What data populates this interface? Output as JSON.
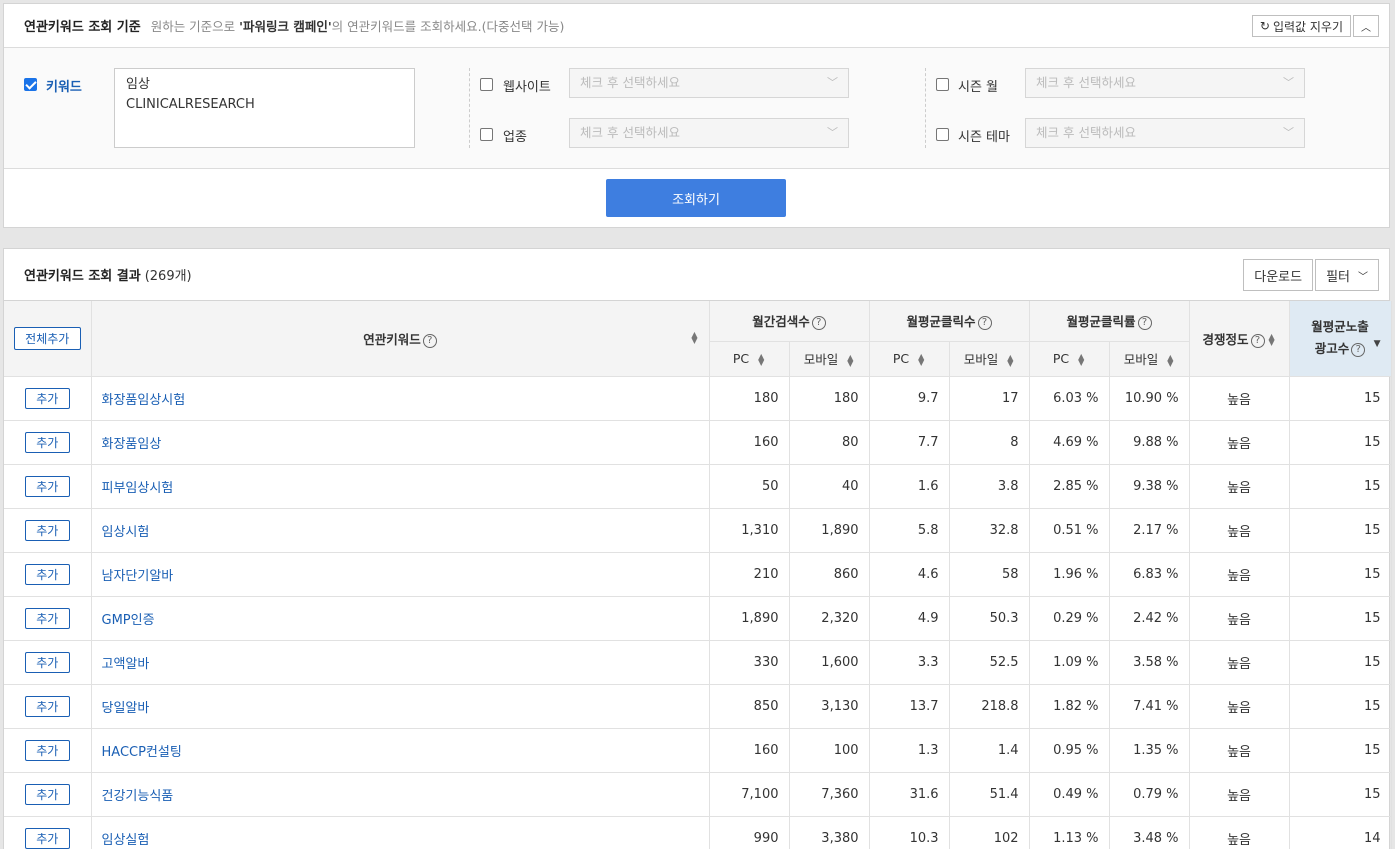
{
  "criteria": {
    "title": "연관키워드 조회 기준",
    "desc_before": "원하는 기준으로 ",
    "desc_bold": "'파워링크 캠페인'",
    "desc_after": "의 연관키워드를 조회하세요.(다중선택 가능)",
    "reset_label": "입력값 지우기",
    "collapse_icon": "chevron-up-icon",
    "keyword_label": "키워드",
    "keyword_lines": [
      "임상",
      "CLINICALRESEARCH"
    ],
    "website_label": "웹사이트",
    "industry_label": "업종",
    "season_month_label": "시즌 월",
    "season_theme_label": "시즌 테마",
    "select_placeholder": "체크 후 선택하세요",
    "search_label": "조회하기"
  },
  "results": {
    "title": "연관키워드 조회 결과",
    "count": "(269개)",
    "download_label": "다운로드",
    "filter_label": "필터",
    "add_all_label": "전체추가",
    "add_label": "추가",
    "headers": {
      "keyword": "연관키워드",
      "monthly_search": "월간검색수",
      "avg_clicks": "월평균클릭수",
      "avg_ctr": "월평균클릭률",
      "competition": "경쟁정도",
      "ad_count_1": "월평균노출",
      "ad_count_2": "광고수",
      "pc": "PC",
      "mobile": "모바일"
    },
    "rows": [
      {
        "kw": "화장품임상시험",
        "s_pc": "180",
        "s_mo": "180",
        "c_pc": "9.7",
        "c_mo": "17",
        "r_pc": "6.03 %",
        "r_mo": "10.90 %",
        "comp": "높음",
        "ads": "15"
      },
      {
        "kw": "화장품임상",
        "s_pc": "160",
        "s_mo": "80",
        "c_pc": "7.7",
        "c_mo": "8",
        "r_pc": "4.69 %",
        "r_mo": "9.88 %",
        "comp": "높음",
        "ads": "15"
      },
      {
        "kw": "피부임상시험",
        "s_pc": "50",
        "s_mo": "40",
        "c_pc": "1.6",
        "c_mo": "3.8",
        "r_pc": "2.85 %",
        "r_mo": "9.38 %",
        "comp": "높음",
        "ads": "15"
      },
      {
        "kw": "임상시험",
        "s_pc": "1,310",
        "s_mo": "1,890",
        "c_pc": "5.8",
        "c_mo": "32.8",
        "r_pc": "0.51 %",
        "r_mo": "2.17 %",
        "comp": "높음",
        "ads": "15"
      },
      {
        "kw": "남자단기알바",
        "s_pc": "210",
        "s_mo": "860",
        "c_pc": "4.6",
        "c_mo": "58",
        "r_pc": "1.96 %",
        "r_mo": "6.83 %",
        "comp": "높음",
        "ads": "15"
      },
      {
        "kw": "GMP인증",
        "s_pc": "1,890",
        "s_mo": "2,320",
        "c_pc": "4.9",
        "c_mo": "50.3",
        "r_pc": "0.29 %",
        "r_mo": "2.42 %",
        "comp": "높음",
        "ads": "15"
      },
      {
        "kw": "고액알바",
        "s_pc": "330",
        "s_mo": "1,600",
        "c_pc": "3.3",
        "c_mo": "52.5",
        "r_pc": "1.09 %",
        "r_mo": "3.58 %",
        "comp": "높음",
        "ads": "15"
      },
      {
        "kw": "당일알바",
        "s_pc": "850",
        "s_mo": "3,130",
        "c_pc": "13.7",
        "c_mo": "218.8",
        "r_pc": "1.82 %",
        "r_mo": "7.41 %",
        "comp": "높음",
        "ads": "15"
      },
      {
        "kw": "HACCP컨설팅",
        "s_pc": "160",
        "s_mo": "100",
        "c_pc": "1.3",
        "c_mo": "1.4",
        "r_pc": "0.95 %",
        "r_mo": "1.35 %",
        "comp": "높음",
        "ads": "15"
      },
      {
        "kw": "건강기능식품",
        "s_pc": "7,100",
        "s_mo": "7,360",
        "c_pc": "31.6",
        "c_mo": "51.4",
        "r_pc": "0.49 %",
        "r_mo": "0.79 %",
        "comp": "높음",
        "ads": "15"
      },
      {
        "kw": "임상실험",
        "s_pc": "990",
        "s_mo": "3,380",
        "c_pc": "10.3",
        "c_mo": "102",
        "r_pc": "1.13 %",
        "r_mo": "3.48 %",
        "comp": "높음",
        "ads": "14"
      }
    ]
  },
  "colors": {
    "accent": "#3e7ee0",
    "link": "#1a5fb4",
    "sorted_header": "#dfeaf3"
  }
}
